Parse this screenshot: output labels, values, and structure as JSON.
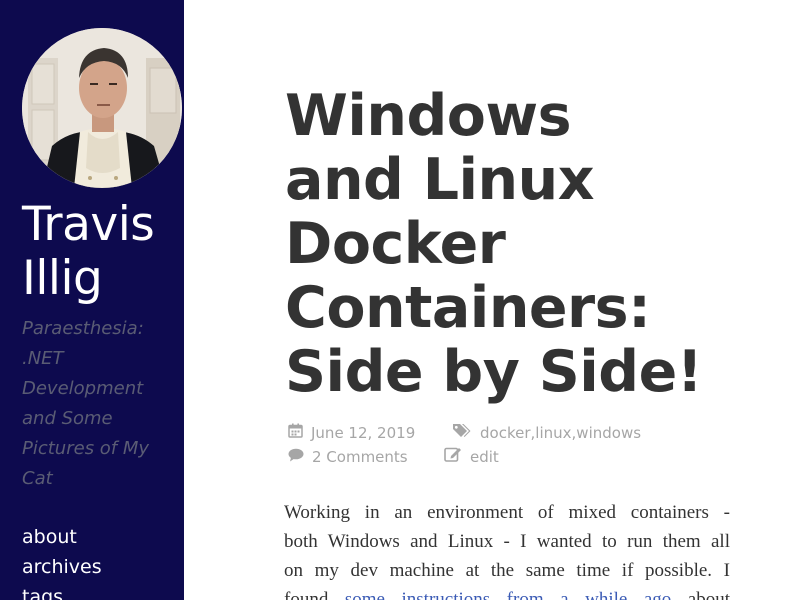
{
  "sidebar": {
    "title_lines": [
      "Travis",
      "Illig"
    ],
    "tagline_lines": [
      "Paraesthesia:",
      ".NET",
      "Development",
      "and Some",
      "Pictures of My",
      "Cat"
    ],
    "nav": [
      {
        "label": "about"
      },
      {
        "label": "archives"
      },
      {
        "label": "tags"
      }
    ]
  },
  "post": {
    "title_lines": [
      "Windows",
      "and Linux",
      "Docker",
      "Containers:",
      "Side by Side!"
    ],
    "date": "June 12, 2019",
    "tags": [
      "docker",
      "linux",
      "windows"
    ],
    "tag_separator": ", ",
    "comments": "2 Comments",
    "edit_label": "edit",
    "body": {
      "line1": "Working in an environment of mixed containers -",
      "line2": "both Windows and Linux - I wanted to run them all",
      "line3": "on my dev machine at the same time if possible. I",
      "line4_pre": "found",
      "line4_link": "some instructions from a while ago",
      "line4_post": "about"
    }
  },
  "colors": {
    "sidebar_bg": "#0d0a4e",
    "title_text": "#333333",
    "meta_text": "#a6a6a6",
    "tagline_text": "#5a5c74",
    "link": "#3b5bb5"
  },
  "icons": {
    "date": "calendar-icon",
    "tags": "tags-icon",
    "comments": "comment-bubble-icon",
    "edit": "edit-icon"
  }
}
